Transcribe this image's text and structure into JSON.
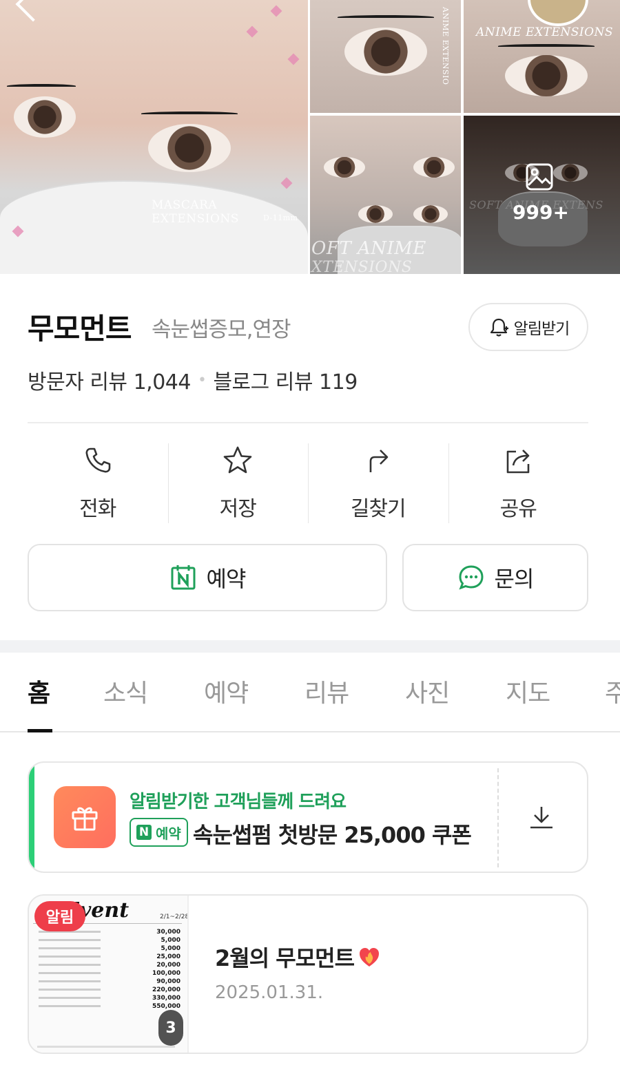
{
  "gallery": {
    "captions": {
      "mascara": "MASCARA EXTENSIONS",
      "mascara_sub": "D-11mm",
      "anime": "ANIME EXTENSIONS",
      "anime_vertical": "ANIME EXTENSIO",
      "soft1": "OFT ANIME",
      "soft2": "XTENSIONS",
      "soft3": "SOFT ANIME EXTENS"
    },
    "more_count": "999+"
  },
  "place": {
    "name": "무모먼트",
    "category": "속눈썹증모,연장",
    "alert_button": "알림받기",
    "visitor_review_label": "방문자 리뷰 1,044",
    "dot": "•",
    "blog_review_label": "블로그 리뷰 119"
  },
  "actions": [
    {
      "label": "전화",
      "icon": "phone-icon"
    },
    {
      "label": "저장",
      "icon": "star-icon"
    },
    {
      "label": "길찾기",
      "icon": "directions-icon"
    },
    {
      "label": "공유",
      "icon": "share-icon"
    }
  ],
  "buttons": {
    "book": "예약",
    "ask": "문의"
  },
  "tabs": [
    "홈",
    "소식",
    "예약",
    "리뷰",
    "사진",
    "지도",
    "주"
  ],
  "active_tab": "홈",
  "coupon": {
    "headline": "알림받기한 고객님들께 드려요",
    "badge_letter": "N",
    "badge_text": "예약",
    "title": "속눈썹펌 첫방문 25,000 쿠폰"
  },
  "news": {
    "tag": "알림",
    "thumb_title": "Event",
    "thumb_date": "2/1~2/28",
    "image_count": "3",
    "title": "2월의 무모먼트",
    "date": "2025.01.31."
  },
  "colors": {
    "accent_green": "#1fa05a",
    "alert_red": "#ee3e4a",
    "gift_orange": "#ff7a5c"
  }
}
